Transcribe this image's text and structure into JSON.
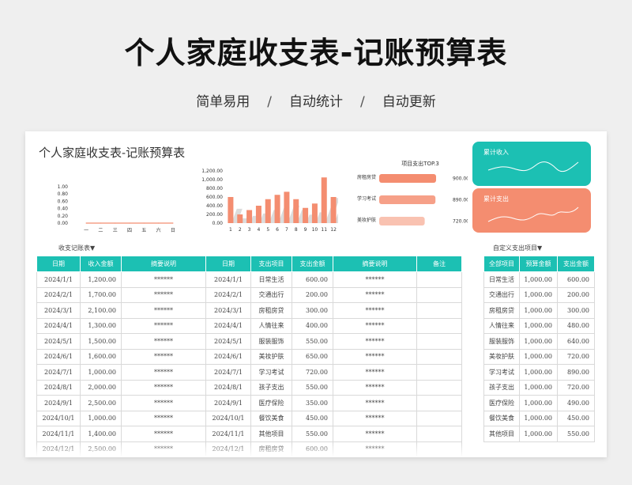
{
  "hero": {
    "title": "个人家庭收支表-记账预算表",
    "tags": [
      "简单易用",
      "自动统计",
      "自动更新"
    ],
    "separator": "/"
  },
  "sheet": {
    "title": "个人家庭收支表-记账预算表",
    "ledger_caption": "收支记账表▼",
    "custom_caption": "自定义支出项目▼",
    "income_card_label": "累计收入",
    "expense_card_label": "累计支出"
  },
  "colors": {
    "teal": "#1cc0b3",
    "coral": "#f48d70"
  },
  "chart_data": [
    {
      "type": "line",
      "categories": [
        "一",
        "二",
        "三",
        "四",
        "五",
        "六",
        "日"
      ],
      "values": [
        0,
        0,
        0,
        0,
        0,
        0,
        0
      ],
      "yticks": [
        "1.00",
        "0.80",
        "0.60",
        "0.40",
        "0.20",
        "0.00"
      ],
      "ylim": [
        0,
        1
      ]
    },
    {
      "type": "bar",
      "categories": [
        "1",
        "2",
        "3",
        "4",
        "5",
        "6",
        "7",
        "8",
        "9",
        "10",
        "11",
        "12"
      ],
      "values": [
        600,
        200,
        300,
        400,
        550,
        650,
        720,
        550,
        350,
        450,
        1050,
        600
      ],
      "yticks": [
        "1,200.00",
        "1,000.00",
        "800.00",
        "600.00",
        "400.00",
        "200.00",
        "0.00"
      ],
      "ylim": [
        0,
        1200
      ]
    },
    {
      "type": "bar",
      "title": "项目支出TOP.3",
      "categories": [
        "房租房贷",
        "学习考试",
        "美妆护肤"
      ],
      "values": [
        900,
        890,
        720
      ],
      "value_labels": [
        "900.00",
        "890.00",
        "720.00"
      ]
    }
  ],
  "ledger": {
    "headers": [
      "日期",
      "收入金额",
      "摘要说明",
      "日期",
      "支出项目",
      "支出金额",
      "摘要说明",
      "备注"
    ],
    "rows": [
      [
        "2024/1/1",
        "1,200.00",
        "******",
        "2024/1/1",
        "日常生活",
        "600.00",
        "******",
        ""
      ],
      [
        "2024/2/1",
        "1,700.00",
        "******",
        "2024/2/1",
        "交通出行",
        "200.00",
        "******",
        ""
      ],
      [
        "2024/3/1",
        "2,100.00",
        "******",
        "2024/3/1",
        "房租房贷",
        "300.00",
        "******",
        ""
      ],
      [
        "2024/4/1",
        "1,300.00",
        "******",
        "2024/4/1",
        "人情往来",
        "400.00",
        "******",
        ""
      ],
      [
        "2024/5/1",
        "1,500.00",
        "******",
        "2024/5/1",
        "服装服饰",
        "550.00",
        "******",
        ""
      ],
      [
        "2024/6/1",
        "1,600.00",
        "******",
        "2024/6/1",
        "美妆护肤",
        "650.00",
        "******",
        ""
      ],
      [
        "2024/7/1",
        "1,000.00",
        "******",
        "2024/7/1",
        "学习考试",
        "720.00",
        "******",
        ""
      ],
      [
        "2024/8/1",
        "2,000.00",
        "******",
        "2024/8/1",
        "孩子支出",
        "550.00",
        "******",
        ""
      ],
      [
        "2024/9/1",
        "2,500.00",
        "******",
        "2024/9/1",
        "医疗保险",
        "350.00",
        "******",
        ""
      ],
      [
        "2024/10/1",
        "1,000.00",
        "******",
        "2024/10/1",
        "餐饮美食",
        "450.00",
        "******",
        ""
      ],
      [
        "2024/11/1",
        "1,400.00",
        "******",
        "2024/11/1",
        "其他项目",
        "550.00",
        "******",
        ""
      ],
      [
        "2024/12/1",
        "2,500.00",
        "******",
        "2024/12/1",
        "房租房贷",
        "600.00",
        "******",
        ""
      ]
    ]
  },
  "budget": {
    "headers": [
      "全部项目",
      "预算金额",
      "支出金额"
    ],
    "rows": [
      [
        "日常生活",
        "1,000.00",
        "600.00"
      ],
      [
        "交通出行",
        "1,000.00",
        "200.00"
      ],
      [
        "房租房贷",
        "1,000.00",
        "300.00"
      ],
      [
        "人情往来",
        "1,000.00",
        "480.00"
      ],
      [
        "服装服饰",
        "1,000.00",
        "640.00"
      ],
      [
        "美妆护肤",
        "1,000.00",
        "720.00"
      ],
      [
        "学习考试",
        "1,000.00",
        "890.00"
      ],
      [
        "孩子支出",
        "1,000.00",
        "720.00"
      ],
      [
        "医疗保险",
        "1,000.00",
        "490.00"
      ],
      [
        "餐饮美食",
        "1,000.00",
        "450.00"
      ],
      [
        "其他项目",
        "1,000.00",
        "550.00"
      ]
    ]
  }
}
